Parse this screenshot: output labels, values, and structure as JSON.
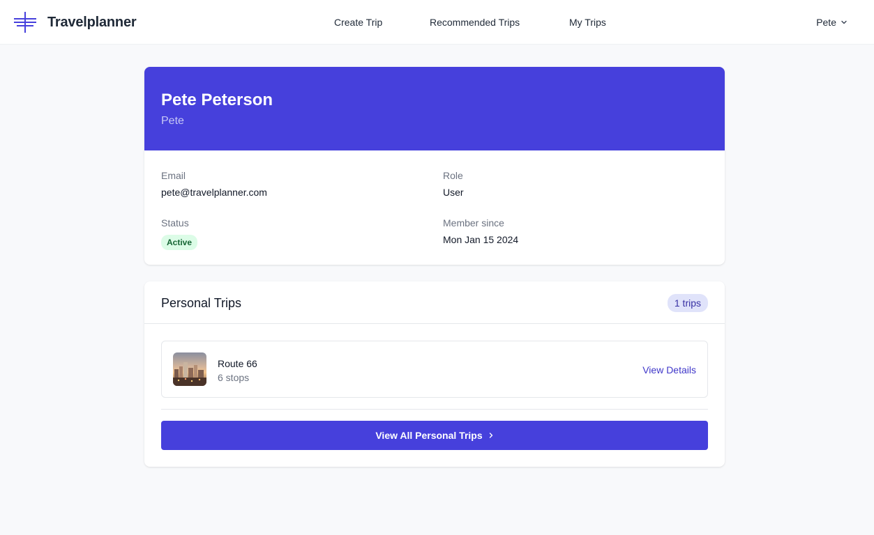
{
  "header": {
    "brand": "Travelplanner",
    "nav": [
      {
        "label": "Create Trip"
      },
      {
        "label": "Recommended Trips"
      },
      {
        "label": "My Trips"
      }
    ],
    "user_menu_label": "Pete",
    "icons": {
      "brand": "travel-logo-icon",
      "user_menu": "chevron-down-icon"
    }
  },
  "profile": {
    "full_name": "Pete Peterson",
    "username": "Pete",
    "email_label": "Email",
    "email": "pete@travelplanner.com",
    "role_label": "Role",
    "role": "User",
    "status_label": "Status",
    "status": "Active",
    "member_since_label": "Member since",
    "member_since": "Mon Jan 15 2024"
  },
  "personal_trips": {
    "title": "Personal Trips",
    "count_badge": "1 trips",
    "trips": [
      {
        "name": "Route 66",
        "stops": "6 stops",
        "action": "View Details"
      }
    ],
    "view_all_label": "View All Personal Trips"
  },
  "colors": {
    "accent": "#4640dc",
    "badge_active_bg": "#dcfce7",
    "badge_active_text": "#166534",
    "count_badge_bg": "#e0e3fa"
  }
}
